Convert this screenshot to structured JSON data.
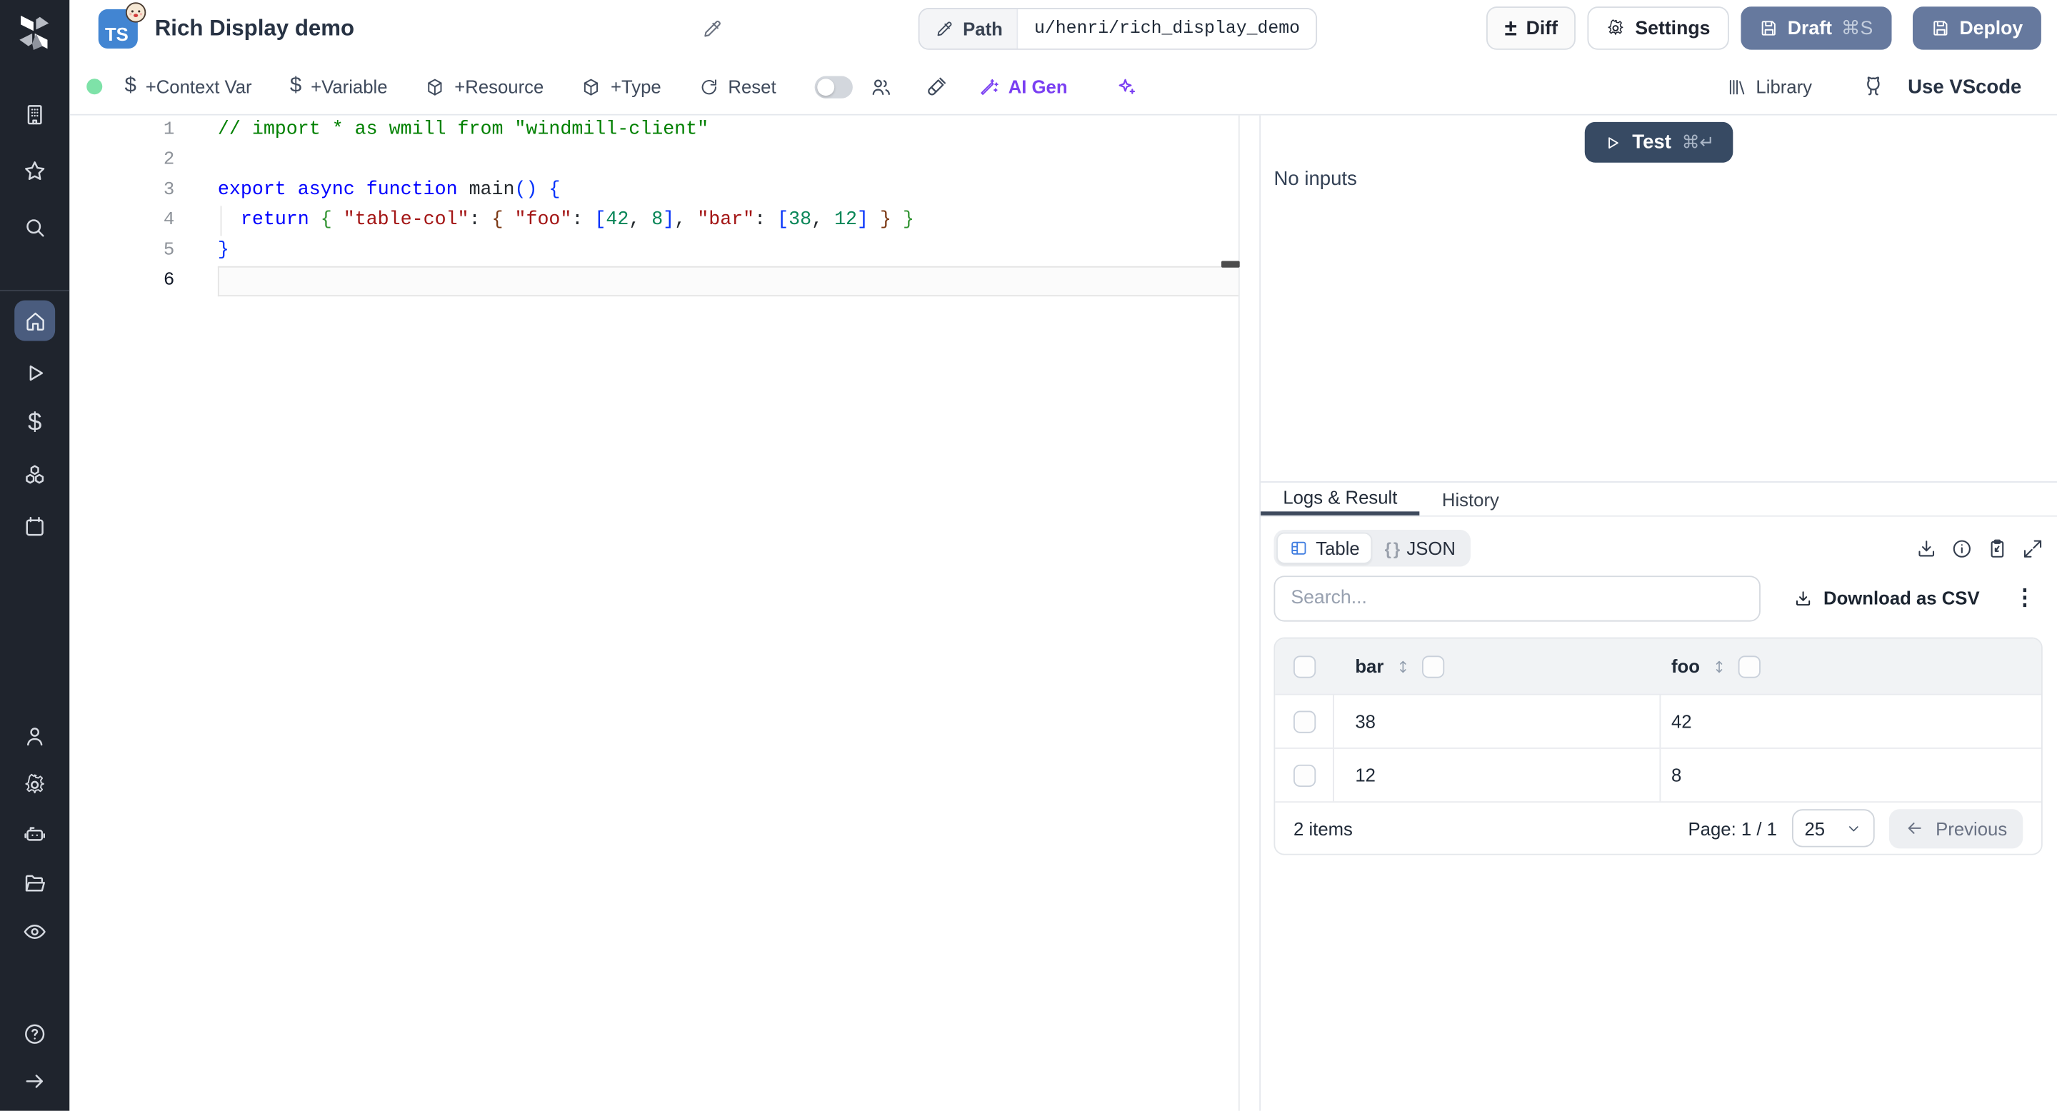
{
  "colors": {
    "sidebar_bg": "#1f242d",
    "active_nav_bg": "#4a5c7e",
    "ts_badge_blue": "#4285d2",
    "slate_button": "#66799e",
    "test_navy": "#374a63",
    "ai_purple": "#7a3ff2",
    "green_status_dot": "#7ee2a8"
  },
  "header": {
    "language_badge": "TS",
    "title": "Rich Display demo",
    "path_label": "Path",
    "path_value": "u/henri/rich_display_demo",
    "diff_label": "Diff",
    "diff_icon_glyph": "±",
    "settings_label": "Settings",
    "draft_label": "Draft",
    "draft_shortcut": "⌘S",
    "deploy_label": "Deploy"
  },
  "toolbar": {
    "context_var_label": "+Context Var",
    "variable_label": "+Variable",
    "resource_label": "+Resource",
    "type_label": "+Type",
    "reset_label": "Reset",
    "ai_gen_label": "AI Gen",
    "library_label": "Library",
    "use_vscode_label": "Use VScode",
    "dollar_glyph": "$"
  },
  "editor": {
    "lines": [
      {
        "num": "1",
        "tokens": [
          [
            "// import * as wmill from \"windmill-client\"",
            "c"
          ]
        ]
      },
      {
        "num": "2",
        "tokens": []
      },
      {
        "num": "3",
        "tokens": [
          [
            "export",
            "k"
          ],
          [
            " ",
            "p"
          ],
          [
            "async",
            "k"
          ],
          [
            " ",
            "p"
          ],
          [
            "function",
            "k"
          ],
          [
            " ",
            "p"
          ],
          [
            "main",
            "fn"
          ],
          [
            "(",
            "b1"
          ],
          [
            ")",
            "b1"
          ],
          [
            " ",
            "p"
          ],
          [
            "{",
            "b1"
          ]
        ]
      },
      {
        "num": "4",
        "tokens": [
          [
            "  ",
            "p"
          ],
          [
            "return",
            "k"
          ],
          [
            " ",
            "p"
          ],
          [
            "{",
            "b2"
          ],
          [
            " ",
            "p"
          ],
          [
            "\"table-col\"",
            "s"
          ],
          [
            ":",
            "p"
          ],
          [
            " ",
            "p"
          ],
          [
            "{",
            "b3"
          ],
          [
            " ",
            "p"
          ],
          [
            "\"foo\"",
            "s"
          ],
          [
            ":",
            "p"
          ],
          [
            " ",
            "p"
          ],
          [
            "[",
            "b1"
          ],
          [
            "42",
            "n"
          ],
          [
            ",",
            "p"
          ],
          [
            " ",
            "p"
          ],
          [
            "8",
            "n"
          ],
          [
            "]",
            "b1"
          ],
          [
            ",",
            "p"
          ],
          [
            " ",
            "p"
          ],
          [
            "\"bar\"",
            "s"
          ],
          [
            ":",
            "p"
          ],
          [
            " ",
            "p"
          ],
          [
            "[",
            "b1"
          ],
          [
            "38",
            "n"
          ],
          [
            ",",
            "p"
          ],
          [
            " ",
            "p"
          ],
          [
            "12",
            "n"
          ],
          [
            "]",
            "b1"
          ],
          [
            " ",
            "p"
          ],
          [
            "}",
            "b3"
          ],
          [
            " ",
            "p"
          ],
          [
            "}",
            "b2"
          ]
        ]
      },
      {
        "num": "5",
        "tokens": [
          [
            "}",
            "b1"
          ]
        ]
      },
      {
        "num": "6",
        "tokens": [],
        "current": true
      }
    ]
  },
  "run_panel": {
    "test_label": "Test",
    "test_shortcut": "⌘↵",
    "no_inputs_text": "No inputs"
  },
  "result_panel": {
    "tabs": [
      {
        "label": "Logs & Result",
        "active": true
      },
      {
        "label": "History",
        "active": false
      }
    ],
    "view_toggle": [
      {
        "label": "Table",
        "active": true
      },
      {
        "label": "JSON",
        "active": false
      }
    ],
    "json_icon_glyph": "{ }",
    "kebab_glyph": "⋮",
    "search_placeholder": "Search...",
    "download_csv_label": "Download as CSV",
    "table": {
      "columns": [
        "bar",
        "foo"
      ],
      "rows": [
        [
          "38",
          "42"
        ],
        [
          "12",
          "8"
        ]
      ],
      "items_count": "2 items",
      "page_label": "Page: 1 / 1",
      "page_size": "25",
      "previous_label": "Previous"
    }
  },
  "sidebar_icons": [
    "workspace-building",
    "favorites-star",
    "search",
    "home",
    "runs-play",
    "variables-dollar",
    "resources-cubes",
    "schedules-calendar",
    "users-person",
    "settings-gear",
    "workers-robot",
    "folders",
    "audit-eye",
    "help-question",
    "expand-arrow"
  ]
}
